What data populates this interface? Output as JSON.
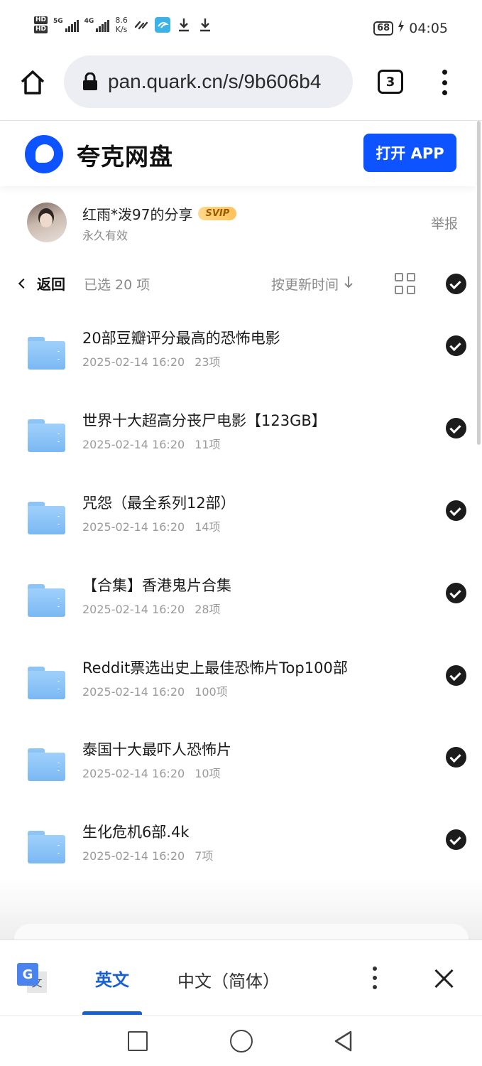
{
  "status_bar": {
    "hd1": "HD",
    "hd2": "HD",
    "net1": "5G",
    "net2": "4G",
    "speed_value": "8.6",
    "speed_unit": "K/s",
    "battery": "68",
    "time": "04:05"
  },
  "browser": {
    "url": "pan.quark.cn/s/9b606b4",
    "tab_count": "3"
  },
  "header": {
    "app_name": "夸克网盘",
    "open_app_button": "打开 APP",
    "brand_color": "#0d53ff"
  },
  "share": {
    "owner_title": "红雨*泼97的分享",
    "badge": "SVIP",
    "validity": "永久有效",
    "report_link": "举报"
  },
  "toolbar": {
    "back_label": "返回",
    "selected_count": "已选 20 项",
    "sort_label": "按更新时间",
    "sort_direction_icon": "arrow-down-icon",
    "view_icon": "grid-view-icon"
  },
  "files": [
    {
      "name": "20部豆瓣评分最高的恐怖电影",
      "date": "2025-02-14 16:20",
      "count": "23项",
      "checked": true
    },
    {
      "name": "世界十大超高分丧尸电影【123GB】",
      "date": "2025-02-14 16:20",
      "count": "11项",
      "checked": true
    },
    {
      "name": "咒怨（最全系列12部）",
      "date": "2025-02-14 16:20",
      "count": "14项",
      "checked": true
    },
    {
      "name": "【合集】香港鬼片合集",
      "date": "2025-02-14 16:20",
      "count": "28项",
      "checked": true
    },
    {
      "name": "Reddit票选出史上最佳恐怖片Top100部",
      "date": "2025-02-14 16:20",
      "count": "100项",
      "checked": true
    },
    {
      "name": "泰国十大最吓人恐怖片",
      "date": "2025-02-14 16:20",
      "count": "10项",
      "checked": true
    },
    {
      "name": "生化危机6部.4k",
      "date": "2025-02-14 16:20",
      "count": "7项",
      "checked": true
    }
  ],
  "translate_bar": {
    "g_icon_letter": "G",
    "g_icon_char": "文",
    "source_language": "英文",
    "target_language": "中文（简体）",
    "accent_color": "#1a5fd0"
  }
}
